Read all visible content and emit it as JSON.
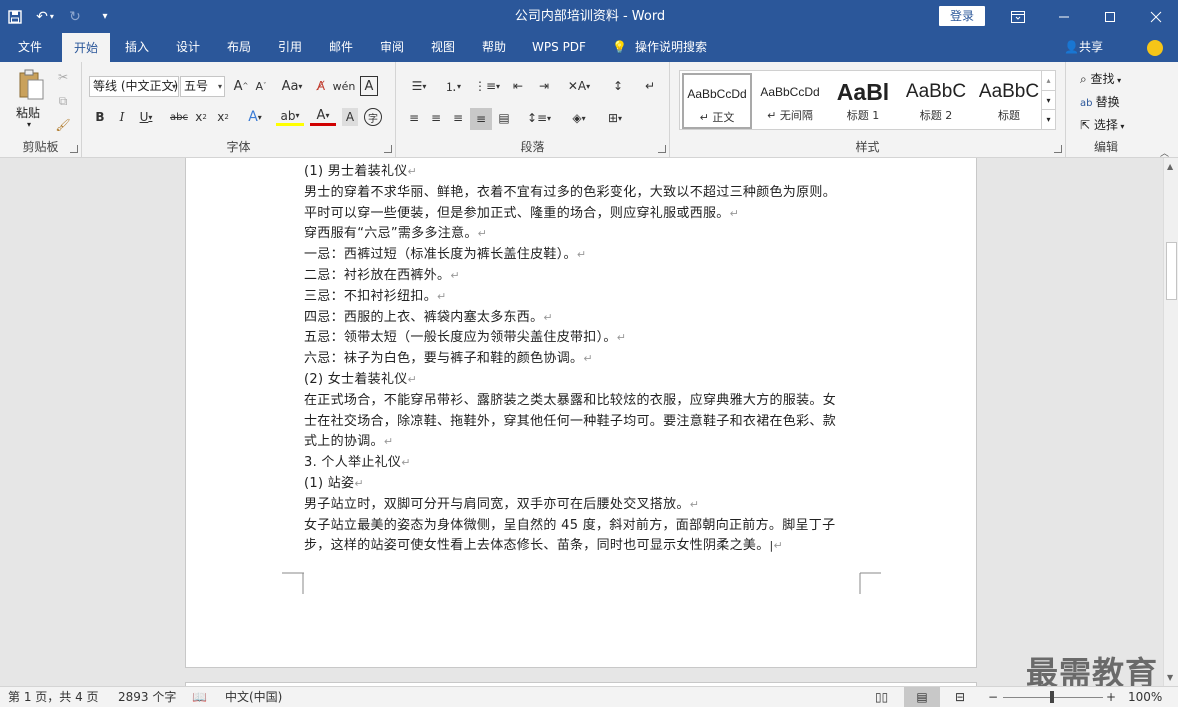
{
  "window": {
    "title": "公司内部培训资料  -  Word",
    "login": "登录"
  },
  "tabs": [
    "文件",
    "开始",
    "插入",
    "设计",
    "布局",
    "引用",
    "邮件",
    "审阅",
    "视图",
    "帮助",
    "WPS PDF",
    "操作说明搜索"
  ],
  "share": "共享",
  "ribbon": {
    "clipboard": {
      "paste": "粘贴",
      "label": "剪贴板"
    },
    "font": {
      "name": "等线 (中文正文)",
      "size": "五号",
      "label": "字体"
    },
    "paragraph": {
      "label": "段落"
    },
    "styles": {
      "label": "样式",
      "items": [
        {
          "preview": "AaBbCcDd",
          "name": "↵ 正文"
        },
        {
          "preview": "AaBbCcDd",
          "name": "↵ 无间隔"
        },
        {
          "preview": "AaBl",
          "name": "标题 1"
        },
        {
          "preview": "AaBbC",
          "name": "标题 2"
        },
        {
          "preview": "AaBbC",
          "name": "标题"
        }
      ]
    },
    "editing": {
      "find": "查找",
      "replace": "替换",
      "select": "选择",
      "label": "编辑"
    }
  },
  "document": {
    "lines": [
      "(1) 男士着装礼仪",
      "男士的穿着不求华丽、鲜艳，衣着不宜有过多的色彩变化，大致以不超过三种颜色为原则。",
      "平时可以穿一些便装，但是参加正式、隆重的场合，则应穿礼服或西服。",
      "穿西服有“六忌”需多多注意。",
      "一忌：西裤过短（标准长度为裤长盖住皮鞋）。",
      "二忌：衬衫放在西裤外。",
      "三忌：不扣衬衫纽扣。",
      "四忌：西服的上衣、裤袋内塞太多东西。",
      "五忌：领带太短（一般长度应为领带尖盖住皮带扣）。",
      "六忌：袜子为白色，要与裤子和鞋的颜色协调。",
      "(2) 女士着装礼仪",
      "在正式场合，不能穿吊带衫、露脐装之类太暴露和比较炫的衣服，应穿典雅大方的服装。女",
      "士在社交场合，除凉鞋、拖鞋外，穿其他任何一种鞋子均可。要注意鞋子和衣裙在色彩、款",
      "式上的协调。",
      "3. 个人举止礼仪",
      "(1) 站姿",
      "男子站立时，双脚可分开与肩同宽，双手亦可在后腰处交叉搭放。",
      "女子站立最美的姿态为身体微侧，呈自然的 45 度，斜对前方，面部朝向正前方。脚呈丁子",
      "步，这样的站姿可使女性看上去体态修长、苗条，同时也可显示女性阴柔之美。"
    ]
  },
  "status": {
    "page": "第 1 页，共 4 页",
    "words": "2893 个字",
    "language": "中文(中国)",
    "zoom": "100%"
  },
  "watermark": "最需教育"
}
